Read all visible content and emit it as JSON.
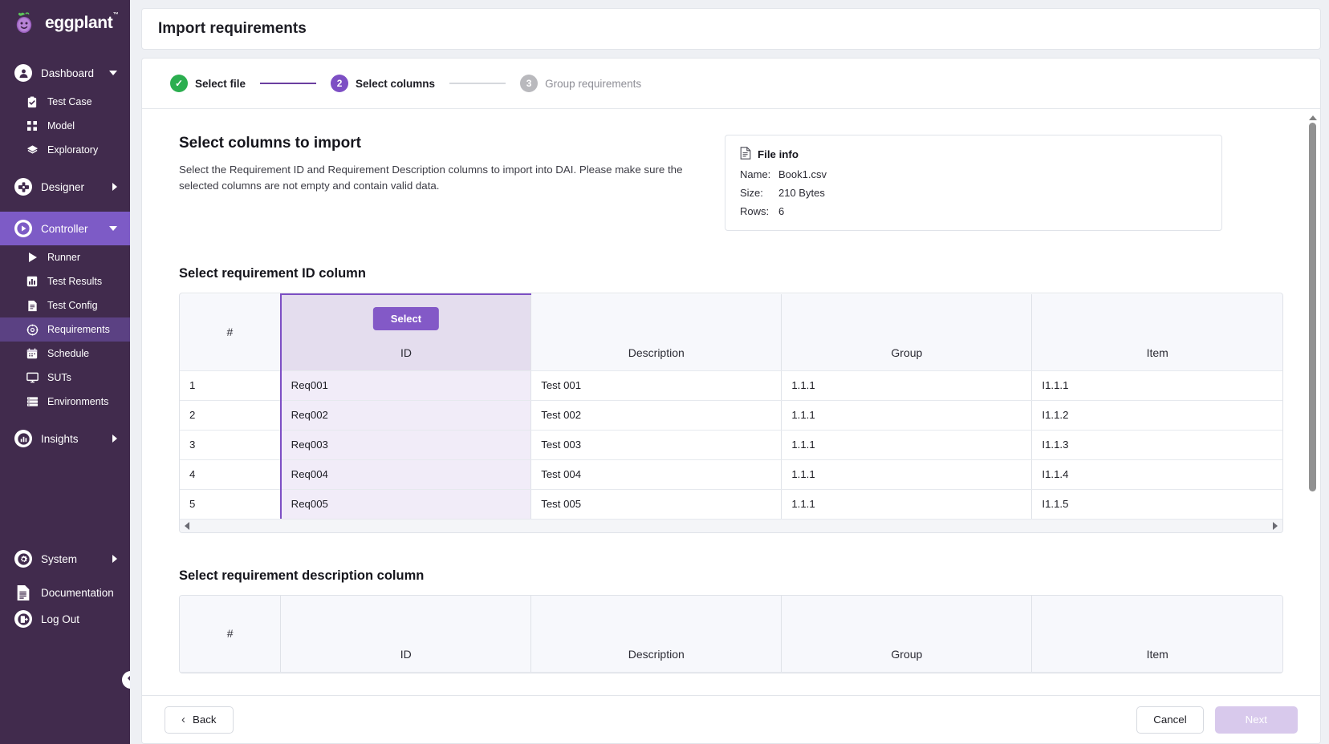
{
  "brand": {
    "name": "eggplant",
    "tm": "™"
  },
  "sidebar": {
    "groups": [
      {
        "label": "Dashboard",
        "icon": "user-circle-icon",
        "caret": "down",
        "active": false,
        "items": [
          {
            "label": "Test Case",
            "icon": "clipboard-check-icon",
            "active": false
          },
          {
            "label": "Model",
            "icon": "grid-squares-icon",
            "active": false
          },
          {
            "label": "Exploratory",
            "icon": "layers-icon",
            "active": false
          }
        ]
      },
      {
        "label": "Designer",
        "icon": "designer-icon",
        "caret": "right",
        "active": false,
        "items": []
      },
      {
        "label": "Controller",
        "icon": "play-circle-icon",
        "caret": "down",
        "active": true,
        "items": [
          {
            "label": "Runner",
            "icon": "play-icon",
            "active": false
          },
          {
            "label": "Test Results",
            "icon": "bar-chart-icon",
            "active": false
          },
          {
            "label": "Test Config",
            "icon": "document-icon",
            "active": false
          },
          {
            "label": "Requirements",
            "icon": "target-icon",
            "active": true
          },
          {
            "label": "Schedule",
            "icon": "calendar-icon",
            "active": false
          },
          {
            "label": "SUTs",
            "icon": "monitor-icon",
            "active": false
          },
          {
            "label": "Environments",
            "icon": "server-icon",
            "active": false
          }
        ]
      },
      {
        "label": "Insights",
        "icon": "insights-chart-icon",
        "caret": "right",
        "active": false,
        "items": []
      }
    ],
    "bottom": [
      {
        "label": "System",
        "icon": "gear-icon",
        "caret": "right"
      },
      {
        "label": "Documentation",
        "icon": "doc-lines-icon",
        "caret": ""
      },
      {
        "label": "Log Out",
        "icon": "logout-icon",
        "caret": ""
      }
    ],
    "collapse_icon": "chevron-left-circle-icon"
  },
  "header": {
    "title": "Import requirements"
  },
  "stepper": {
    "steps": [
      {
        "num": "✓",
        "label": "Select file",
        "state": "done"
      },
      {
        "num": "2",
        "label": "Select columns",
        "state": "current"
      },
      {
        "num": "3",
        "label": "Group requirements",
        "state": "todo"
      }
    ]
  },
  "main": {
    "section_title": "Select columns to import",
    "section_desc": "Select the Requirement ID and Requirement Description columns to import into DAI. Please make sure the selected columns are not empty and contain valid data.",
    "file_info": {
      "icon": "file-document-icon",
      "heading": "File info",
      "rows": [
        {
          "key": "Name:",
          "value": "Book1.csv"
        },
        {
          "key": "Size:",
          "value": "210 Bytes"
        },
        {
          "key": "Rows:",
          "value": "6"
        }
      ]
    },
    "table_id": {
      "title": "Select requirement ID column",
      "select_button": "Select",
      "selected_column_index": 1,
      "headers": [
        "#",
        "ID",
        "Description",
        "Group",
        "Item"
      ],
      "rows": [
        [
          "1",
          "Req001",
          "Test 001",
          "1.1.1",
          "I1.1.1"
        ],
        [
          "2",
          "Req002",
          "Test 002",
          "1.1.1",
          "I1.1.2"
        ],
        [
          "3",
          "Req003",
          "Test 003",
          "1.1.1",
          "I1.1.3"
        ],
        [
          "4",
          "Req004",
          "Test 004",
          "1.1.1",
          "I1.1.4"
        ],
        [
          "5",
          "Req005",
          "Test 005",
          "1.1.1",
          "I1.1.5"
        ]
      ]
    },
    "table_desc": {
      "title": "Select requirement description column",
      "headers": [
        "#",
        "ID",
        "Description",
        "Group",
        "Item"
      ]
    }
  },
  "footer": {
    "back": "Back",
    "back_icon": "chevron-left-icon",
    "cancel": "Cancel",
    "next": "Next"
  },
  "colors": {
    "sidebar_bg": "#412B4D",
    "accent_purple": "#7D4FC4",
    "active_group": "#7D5BC6",
    "active_item": "#5B4183",
    "done_green": "#2BAE4F",
    "todo_grey": "#b9b9bd",
    "page_bg": "#eef0f4",
    "next_disabled": "#d8c9ec"
  }
}
